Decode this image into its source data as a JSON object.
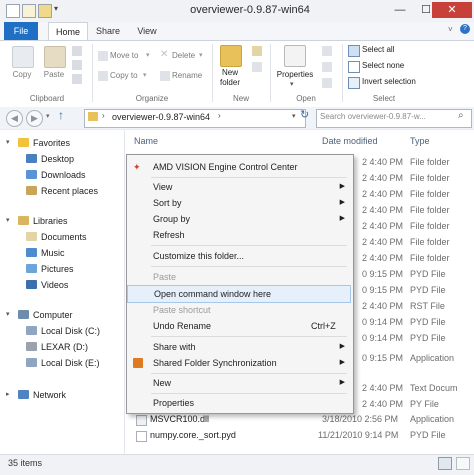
{
  "window": {
    "title": "overviewer-0.9.87-win64",
    "controls": {
      "minimize": "—",
      "maximize": "☐",
      "close": "✕"
    }
  },
  "ribbon_tabs": [
    "File",
    "Home",
    "Share",
    "View"
  ],
  "ribbon": {
    "copy": "Copy",
    "paste": "Paste",
    "move_to": "Move to",
    "copy_to": "Copy to",
    "delete": "Delete",
    "rename": "Rename",
    "new_folder_line1": "New",
    "new_folder_line2": "folder",
    "properties": "Properties",
    "select_all": "Select all",
    "select_none": "Select none",
    "invert_selection": "Invert selection",
    "groups": {
      "clipboard": "Clipboard",
      "organize": "Organize",
      "new": "New",
      "open": "Open",
      "select": "Select"
    }
  },
  "address": {
    "path": "overviewer-0.9.87-win64",
    "search_placeholder": "Search overviewer-0.9.87-w..."
  },
  "nav": {
    "favorites": "Favorites",
    "favorites_items": [
      "Desktop",
      "Downloads",
      "Recent places"
    ],
    "libraries": "Libraries",
    "libraries_items": [
      "Documents",
      "Music",
      "Pictures",
      "Videos"
    ],
    "computer": "Computer",
    "computer_items": [
      "Local Disk (C:)",
      "LEXAR (D:)",
      "Local Disk (E:)"
    ],
    "network": "Network"
  },
  "columns": {
    "name": "Name",
    "date": "Date modified",
    "type": "Type"
  },
  "rows": [
    {
      "name": "",
      "date": "2 4:40 PM",
      "type": "File folder"
    },
    {
      "name": "",
      "date": "2 4:40 PM",
      "type": "File folder"
    },
    {
      "name": "",
      "date": "2 4:40 PM",
      "type": "File folder"
    },
    {
      "name": "",
      "date": "2 4:40 PM",
      "type": "File folder"
    },
    {
      "name": "",
      "date": "2 4:40 PM",
      "type": "File folder"
    },
    {
      "name": "",
      "date": "2 4:40 PM",
      "type": "File folder"
    },
    {
      "name": "",
      "date": "2 4:40 PM",
      "type": "File folder"
    },
    {
      "name": "",
      "date": "0 9:15 PM",
      "type": "PYD File"
    },
    {
      "name": "",
      "date": "0 9:15 PM",
      "type": "PYD File"
    },
    {
      "name": "",
      "date": "2 4:40 PM",
      "type": "RST File"
    },
    {
      "name": "",
      "date": "0 9:14 PM",
      "type": "PYD File"
    },
    {
      "name": "",
      "date": "0 9:14 PM",
      "type": "PYD File"
    },
    {
      "name": "",
      "date": "0 9:15 PM",
      "type": "Application"
    },
    {
      "name": "",
      "date": "2 4:40 PM",
      "type": "Text Docum"
    },
    {
      "name": "",
      "date": "2 4:40 PM",
      "type": "PY File"
    },
    {
      "name": "MSVCR100.dll",
      "date": "3/18/2010 2:56 PM",
      "type": "Application"
    },
    {
      "name": "numpy.core._sort.pyd",
      "date": "11/21/2010 9:14 PM",
      "type": "PYD File"
    }
  ],
  "context_menu": {
    "amd": "AMD VISION Engine Control Center",
    "view": "View",
    "sort_by": "Sort by",
    "group_by": "Group by",
    "refresh": "Refresh",
    "customize": "Customize this folder...",
    "paste": "Paste",
    "open_cmd": "Open command window here",
    "paste_shortcut": "Paste shortcut",
    "undo_rename": "Undo Rename",
    "undo_shortcut": "Ctrl+Z",
    "share_with": "Share with",
    "shared_sync": "Shared Folder Synchronization",
    "new": "New",
    "properties": "Properties"
  },
  "status": {
    "item_count": "35 items"
  },
  "colors": {
    "accent": "#1f6fc4",
    "folder": "#e8c15a",
    "highlight": "#e5f0fb"
  }
}
